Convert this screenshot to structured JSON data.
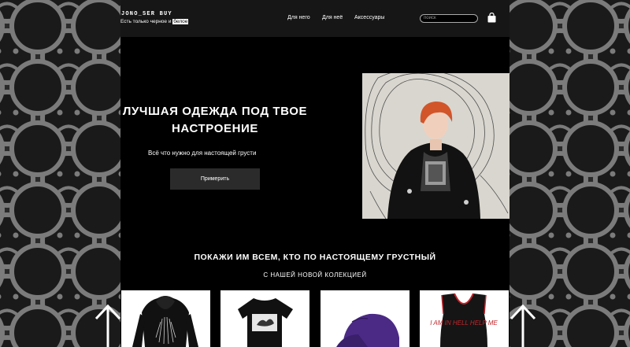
{
  "brand": {
    "logo": "JONO_SER BUY",
    "tagline_prefix": "Есть только черное и ",
    "tagline_highlight": "белое"
  },
  "nav": {
    "items": [
      "Для него",
      "Для неё",
      "Аксессуары"
    ]
  },
  "search": {
    "placeholder": "поиск"
  },
  "icons": {
    "cart": "shopping-bag-icon",
    "logo": "logo-dot-icon",
    "background": "sad-face-icon",
    "arrow": "arrow-up-icon"
  },
  "hero": {
    "title": "ЛУЧШАЯ ОДЕЖДА ПОД ТВОЕ НАСТРОЕНИЕ",
    "subtitle": "Всё что нужно для настоящей грусти",
    "button": "Примерить"
  },
  "collection": {
    "title": "ПОКАЖИ ИМ ВСЕМ, КТО ПО НАСТОЯЩЕМУ ГРУСТНЫЙ",
    "subtitle": "С НАШЕЙ НОВОЙ КОЛЕКЦИЕЙ",
    "products": [
      "hoodie",
      "t-shirt",
      "cap",
      "vest"
    ],
    "vest_print": "I AM IN HELL HELP ME"
  },
  "colors": {
    "page_bg": "#000000",
    "header_bg": "#161616",
    "button_bg": "#2b2b2b",
    "pattern_bg": "#2a2a2a",
    "pattern_stroke": "#7b7b7b",
    "cap": "#4b2a86",
    "vest_print": "#c0262c"
  }
}
